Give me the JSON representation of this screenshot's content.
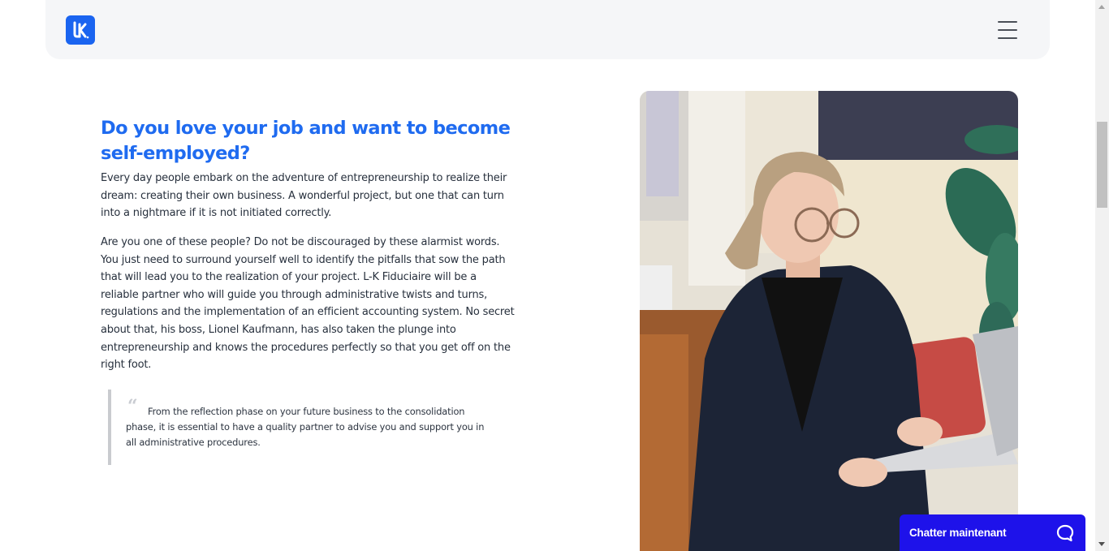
{
  "header": {
    "logo_text": "LK",
    "menu_icon": "hamburger-menu-icon"
  },
  "main": {
    "title": "Do you love your job and want to become self-employed?",
    "paragraph_1": "Every day people embark on the adventure of entrepreneurship to realize their dream: creating their own business. A wonderful project, but one that can turn into a nightmare if it is not initiated correctly.",
    "paragraph_2": "Are you one of these people? Do not be discouraged by these alarmist words. You just need to surround yourself well to identify the pitfalls that sow the path that will lead you to the realization of your project. L-K Fiduciaire will be a reliable partner who will guide you through administrative twists and turns, regulations and the implementation of an efficient accounting system. No secret about that, his boss, Lionel Kaufmann, has also taken the plunge into entrepreneurship and knows the procedures perfectly so that you get off on the right foot.",
    "quote_mark": "“",
    "quote": "From the reflection phase on your future business to the consolidation phase, it is essential to have a quality partner to advise you and support you in all administrative procedures."
  },
  "chat": {
    "label": "Chatter maintenant",
    "icon": "chat-bubble-icon"
  },
  "colors": {
    "brand_blue": "#1f6bf0",
    "chat_blue": "#1e12ea",
    "header_bg": "#f5f6f8"
  }
}
